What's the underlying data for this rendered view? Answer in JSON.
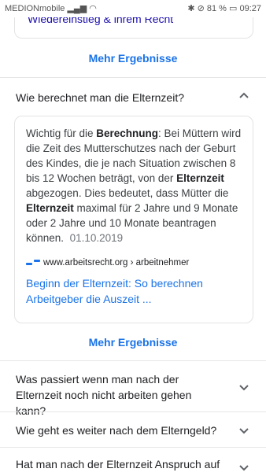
{
  "status": {
    "carrier": "MEDIONmobile",
    "battery": "81 %",
    "time": "09:27"
  },
  "prev_cut_text": "Wiedereinstieg & ihrem Recht",
  "more_results": "Mehr Ergebnisse",
  "questions": [
    {
      "text": "Wie berechnet man die Elternzeit?",
      "expanded": true
    },
    {
      "text": "Was passiert wenn man nach der Elternzeit noch nicht arbeiten gehen kann?",
      "expanded": false
    },
    {
      "text": "Wie geht es weiter nach dem Elterngeld?",
      "expanded": false
    },
    {
      "text": "Hat man nach der Elternzeit Anspruch auf",
      "expanded": false
    }
  ],
  "answer": {
    "p1": "Wichtig für die ",
    "b1": "Berechnung",
    "p2": ": Bei Müttern wird die Zeit des Mutterschutzes nach der Geburt des Kindes, die je nach Situation zwischen 8 bis 12 Wochen beträgt, von der ",
    "b2": "Elternzeit",
    "p3": " abgezogen. Dies bedeutet, dass Mütter die ",
    "b3": "Elternzeit",
    "p4": " maximal für 2 Jahre und 9 Monate oder 2 Jahre und 10 Monate beantragen können.",
    "date": "01.10.2019",
    "source": "www.arbeitsrecht.org › arbeitnehmer",
    "link": "Beginn der Elternzeit: So berechnen Arbeitgeber die Auszeit ..."
  },
  "icons": {
    "chevron_up": "chevron-up-icon",
    "chevron_down": "chevron-down-icon",
    "source_logo": "arbeitsrecht-logo-icon"
  },
  "colors": {
    "link": "#1a73e8",
    "text": "#202124"
  }
}
